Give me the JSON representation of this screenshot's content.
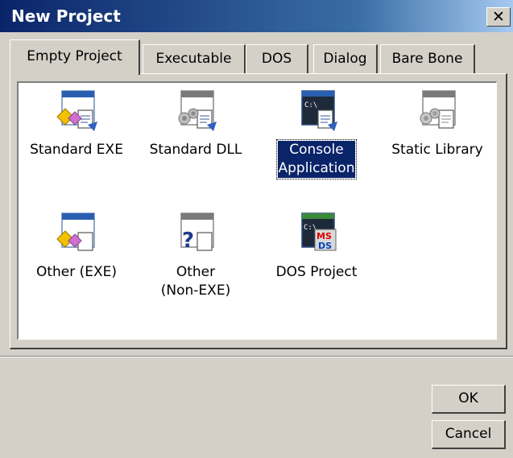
{
  "window": {
    "title": "New Project",
    "close_glyph": "✕"
  },
  "tabs": [
    {
      "label": "Empty Project",
      "active": true
    },
    {
      "label": "Executable",
      "active": false
    },
    {
      "label": "DOS",
      "active": false
    },
    {
      "label": "Dialog",
      "active": false
    },
    {
      "label": "Bare Bone",
      "active": false
    }
  ],
  "templates": [
    {
      "label_lines": [
        "Standard EXE"
      ],
      "icon": "standard-exe-icon"
    },
    {
      "label_lines": [
        "Standard DLL"
      ],
      "icon": "standard-dll-icon"
    },
    {
      "label_lines": [
        "Console",
        "Application"
      ],
      "icon": "console-application-icon",
      "selected": true
    },
    {
      "label_lines": [
        "Static Library"
      ],
      "icon": "static-library-icon"
    },
    {
      "label_lines": [
        "Other (EXE)"
      ],
      "icon": "other-exe-icon"
    },
    {
      "label_lines": [
        "Other",
        "(Non-EXE)"
      ],
      "icon": "other-non-exe-icon"
    },
    {
      "label_lines": [
        "DOS Project"
      ],
      "icon": "dos-project-icon"
    }
  ],
  "buttons": {
    "ok": "OK",
    "cancel": "Cancel"
  },
  "colors": {
    "titlebar": "#0a246a",
    "face": "#d4d0c8",
    "selection": "#0a246a"
  }
}
